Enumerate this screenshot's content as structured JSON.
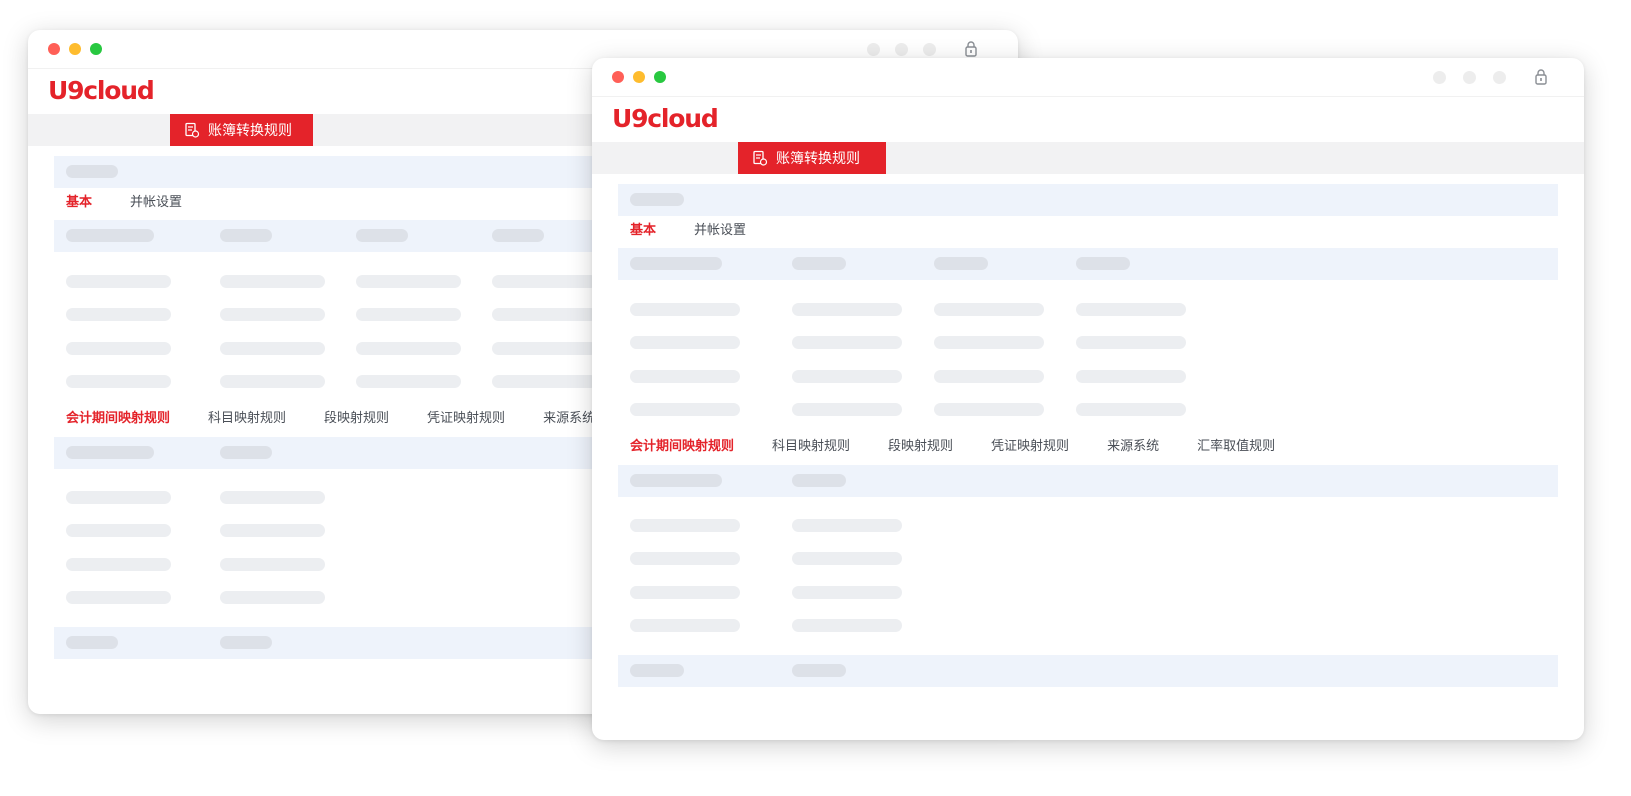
{
  "colors": {
    "accent": "#e4232a",
    "dot_red": "#ff5f57",
    "dot_yellow": "#febc2e",
    "dot_green": "#28c840"
  },
  "icons": {
    "tab_icon": "document-icon",
    "titlebar_icon": "lock-icon"
  },
  "app": {
    "logo_prefix": "U9",
    "logo_suffix": "cloud",
    "active_tab": "账簿转换规则",
    "section_tabs": [
      "基本",
      "并帐设置"
    ],
    "mapping_tabs": [
      "会计期间映射规则",
      "科目映射规则",
      "段映射规则",
      "凭证映射规则",
      "来源系统",
      "汇率取值规则"
    ],
    "active_section_tab": "基本",
    "active_mapping_tab": "会计期间映射规则"
  }
}
